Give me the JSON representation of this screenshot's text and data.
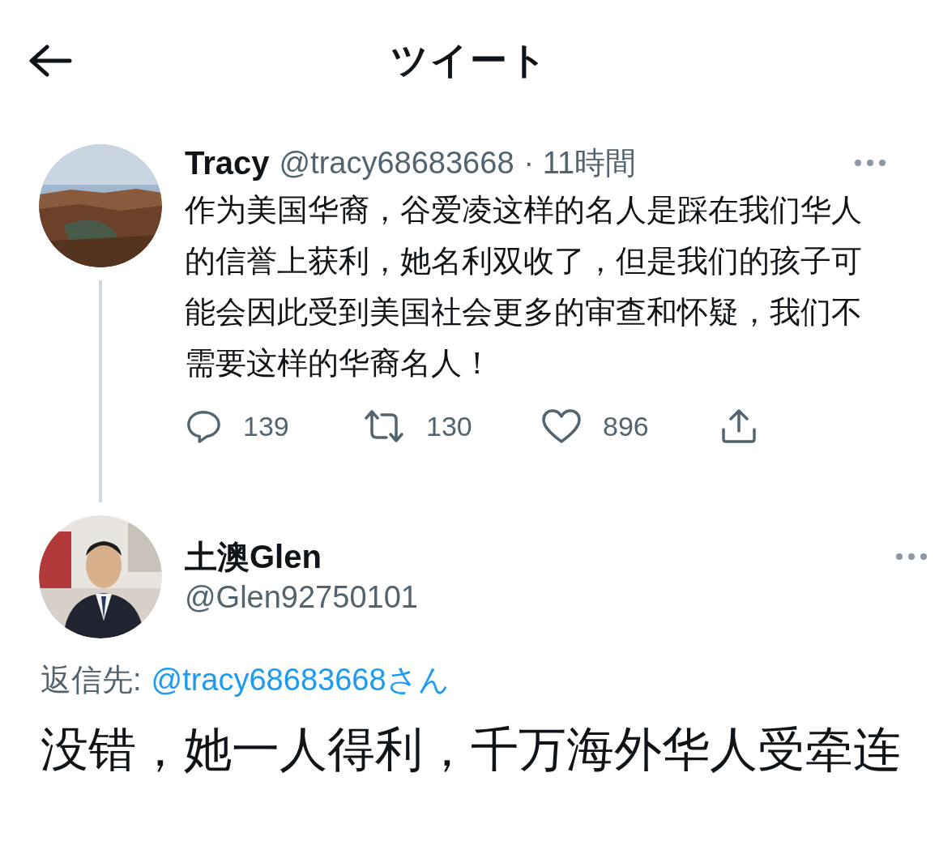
{
  "header": {
    "title": "ツイート"
  },
  "tweet": {
    "name": "Tracy",
    "handle": "@tracy68683668",
    "time": "· 11時間",
    "text": "作为美国华裔，谷爱凌这样的名人是踩在我们华人的信誉上获利，她名利双收了，但是我们的孩子可能会因此受到美国社会更多的审查和怀疑，我们不需要这样的华裔名人！",
    "actions": [
      {
        "kind": "reply",
        "count": "139"
      },
      {
        "kind": "retweet",
        "count": "130"
      },
      {
        "kind": "like",
        "count": "896"
      },
      {
        "kind": "share"
      }
    ]
  },
  "reply": {
    "name": "土澳Glen",
    "handle": "@Glen92750101",
    "reply_to_label": "返信先:",
    "reply_to_handle": "@tracy68683668さん",
    "text": "没错，她一人得利，千万海外华人受牵连"
  }
}
